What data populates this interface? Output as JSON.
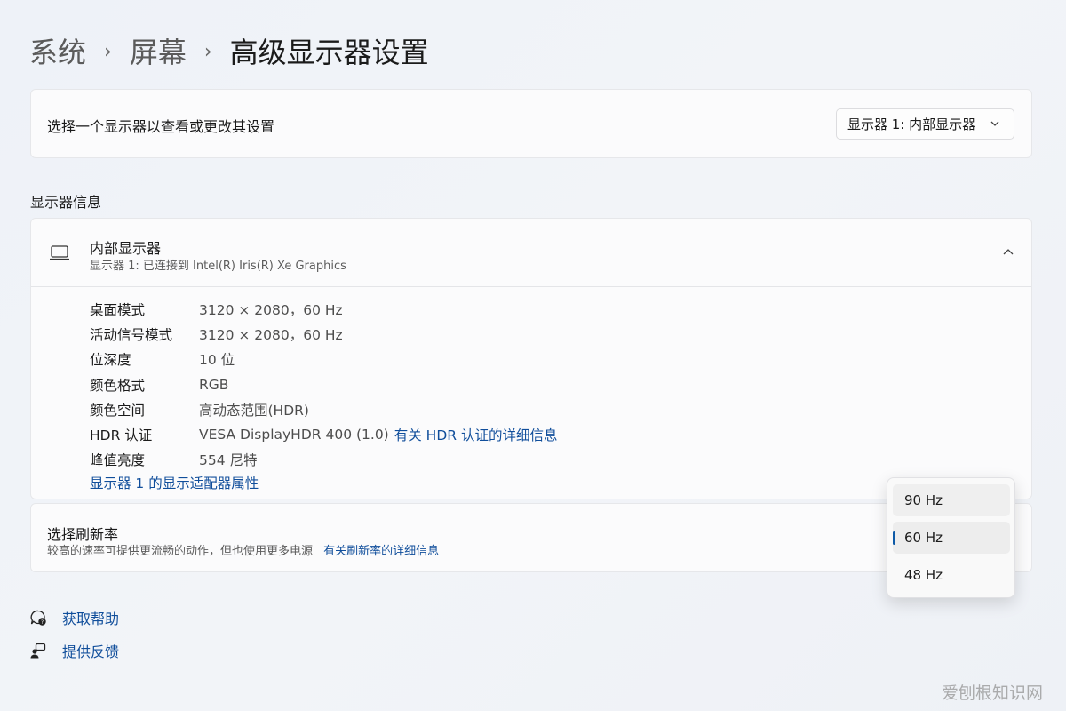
{
  "breadcrumb": {
    "items": [
      "系统",
      "屏幕"
    ],
    "current": "高级显示器设置",
    "separator": "›"
  },
  "display_select": {
    "label": "选择一个显示器以查看或更改其设置",
    "selected": "显示器 1: 内部显示器"
  },
  "display_info": {
    "section_title": "显示器信息",
    "title": "内部显示器",
    "subtitle": "显示器 1: 已连接到 Intel(R) Iris(R) Xe Graphics",
    "rows": [
      {
        "key": "桌面模式",
        "value": "3120 × 2080，60 Hz"
      },
      {
        "key": "活动信号模式",
        "value": "3120 × 2080，60 Hz"
      },
      {
        "key": "位深度",
        "value": "10 位"
      },
      {
        "key": "颜色格式",
        "value": "RGB"
      },
      {
        "key": "颜色空间",
        "value": "高动态范围(HDR)"
      },
      {
        "key": "HDR 认证",
        "value": "VESA DisplayHDR 400 (1.0)"
      },
      {
        "key": "峰值亮度",
        "value": "554 尼特"
      }
    ],
    "hdr_link": "有关 HDR 认证的详细信息",
    "adapter_link": "显示器 1 的显示适配器属性"
  },
  "refresh": {
    "title": "选择刷新率",
    "description": "较高的速率可提供更流畅的动作，但也使用更多电源",
    "link": "有关刷新率的详细信息",
    "options": [
      "90 Hz",
      "60 Hz",
      "48 Hz"
    ],
    "selected_index": 1
  },
  "help": {
    "get_help": "获取帮助",
    "feedback": "提供反馈"
  },
  "watermark": "爱刨根知识网",
  "colors": {
    "accent": "#0e5aa7",
    "link": "#104e9b"
  }
}
